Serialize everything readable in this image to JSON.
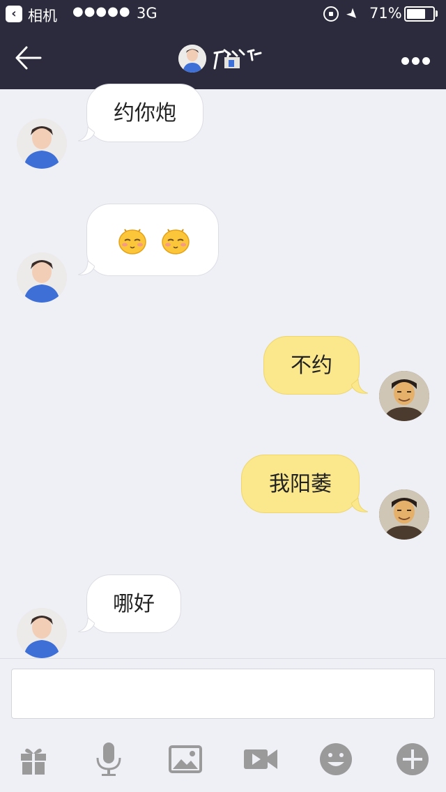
{
  "status_bar": {
    "back_app_label": "相机",
    "signal": "●●●●●",
    "network": "3G",
    "battery_pct": "71%",
    "battery_level": 0.71
  },
  "nav": {
    "back_icon": "back-arrow-icon",
    "more_icon": "more-dots-icon"
  },
  "messages": [
    {
      "sender": "contact",
      "text": "约你炮"
    },
    {
      "sender": "contact",
      "emoji": [
        "blush-emoji",
        "blush-emoji"
      ]
    },
    {
      "sender": "me",
      "text": "不约"
    },
    {
      "sender": "me",
      "text": "我阳萎"
    },
    {
      "sender": "contact",
      "text": "哪好"
    }
  ],
  "input": {
    "value": "",
    "placeholder": ""
  },
  "toolbar": {
    "items": [
      "gift-icon",
      "microphone-icon",
      "image-icon",
      "video-icon",
      "emoji-icon",
      "plus-icon"
    ]
  },
  "colors": {
    "header": "#2b2b3d",
    "background": "#efeff6",
    "bubble_out": "#fbe88c",
    "bubble_in": "#ffffff",
    "toolbar_icon": "#9a9a9a"
  }
}
